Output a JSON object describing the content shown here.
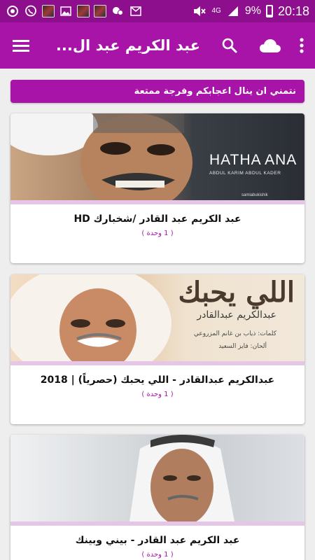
{
  "status_bar": {
    "network": "4G",
    "battery": "9%",
    "time": "20:18",
    "left_icons": [
      "sync-icon",
      "whatsapp-icon",
      "video-thumb-icon",
      "image-icon",
      "video-thumb-icon",
      "video-thumb-icon",
      "chat-icon",
      "mail-icon"
    ],
    "right_icons": [
      "mute-icon",
      "signal-icon",
      "battery-icon"
    ]
  },
  "app_bar": {
    "title": "عبد الكريم عبد ال...",
    "menu_icon": "hamburger-menu-icon",
    "search_icon": "search-icon",
    "cloud_icon": "cloud-icon",
    "more_icon": "more-vert-icon"
  },
  "banner": {
    "text": "نتمني ان ينال اعجابكم وفرجة ممتعة"
  },
  "cards": [
    {
      "title": "عبد الكريم عبد القادر /شخبارك HD",
      "count": "( 1 وحدة )",
      "image_text": {
        "main": "HATHA ANA",
        "sub": "ABDUL KARIM ABDUL KADER",
        "tag": "samiabukishik"
      }
    },
    {
      "title": "عبدالكريم عبدالقادر - اللي يحبك (حصرياً) | 2018",
      "count": "( 1 وحدة )",
      "image_text": {
        "main": "اللي يحبك",
        "artist": "عبدالكريم عبدالقادر",
        "lyrics": "كلمات: ذياب بن غانم المزروعي",
        "composer": "ألحان: فايز السعيد"
      }
    },
    {
      "title": "عبد الكريم عبد القادر - بيني وبينك",
      "count": "( 1 وحدة )",
      "image_text": {}
    }
  ],
  "colors": {
    "status_bar": "#8e0f8e",
    "app_bar": "#a813a8",
    "accent": "#a813a8",
    "background": "#eeeeee"
  }
}
